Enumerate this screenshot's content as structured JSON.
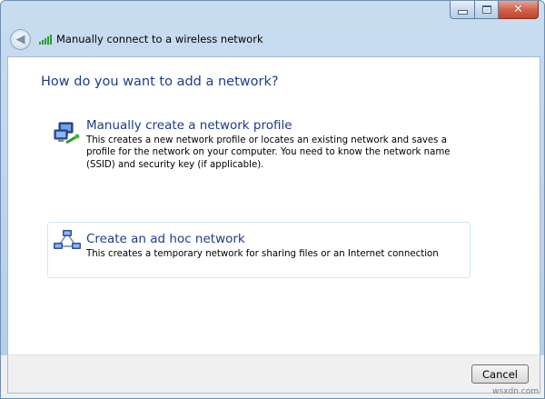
{
  "window": {
    "title": "Manually connect to a wireless network",
    "close_glyph": "✕",
    "back_glyph": "◀"
  },
  "main": {
    "heading": "How do you want to add a network?",
    "options": [
      {
        "title": "Manually create a network profile",
        "description": "This creates a new network profile or locates an existing network and saves a profile for the network on your computer. You need to know the network name (SSID) and security key (if applicable).",
        "icon": "network-computers-icon"
      },
      {
        "title": "Create an ad hoc network",
        "description": "This creates a temporary network for sharing files or an Internet connection",
        "icon": "adhoc-network-icon"
      }
    ]
  },
  "footer": {
    "cancel_label": "Cancel",
    "watermark": "wsxdn.com"
  },
  "colors": {
    "heading": "#1e3c8c",
    "frame": "#b9d1ea",
    "adhoc_highlight": "#cfe8f5"
  }
}
